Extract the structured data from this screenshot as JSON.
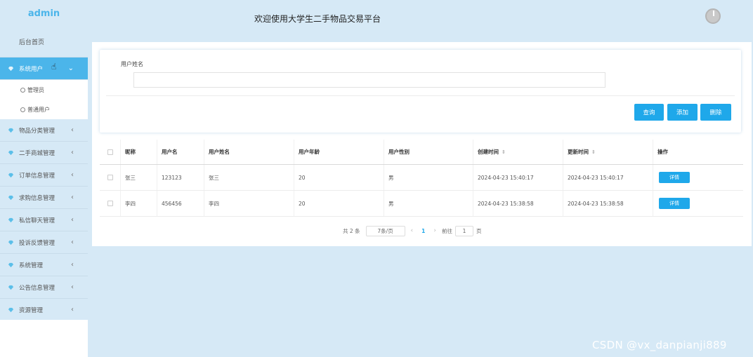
{
  "sidebar": {
    "brand": "admin",
    "home": "后台首页",
    "menus": [
      {
        "label": "系统用户",
        "icon": "gem-icon",
        "active": true
      },
      {
        "label": "物品分类管理",
        "icon": "gem-icon"
      },
      {
        "label": "二手商城管理",
        "icon": "gem-icon"
      },
      {
        "label": "订单信息管理",
        "icon": "gem-icon"
      },
      {
        "label": "求购信息管理",
        "icon": "gem-icon"
      },
      {
        "label": "私信聊天管理",
        "icon": "gem-icon"
      },
      {
        "label": "投诉反馈管理",
        "icon": "gem-icon"
      },
      {
        "label": "系统管理",
        "icon": "gem-icon"
      },
      {
        "label": "公告信息管理",
        "icon": "gem-icon"
      },
      {
        "label": "资源管理",
        "icon": "gem-icon"
      }
    ],
    "submenu": [
      "管理员",
      "普通用户"
    ]
  },
  "header": {
    "title": "欢迎使用大学生二手物品交易平台"
  },
  "search": {
    "label": "用户姓名",
    "value": "",
    "query_label": "查询",
    "add_label": "添加",
    "delete_label": "删除"
  },
  "table": {
    "headers": [
      "昵称",
      "用户名",
      "用户姓名",
      "用户年龄",
      "用户性别",
      "创建时间",
      "更新时间",
      "操作"
    ],
    "rows": [
      {
        "nickname": "张三",
        "username": "123123",
        "realname": "张三",
        "age": "20",
        "gender": "男",
        "created": "2024-04-23 15:40:17",
        "updated": "2024-04-23 15:40:17",
        "action": "详情"
      },
      {
        "nickname": "李四",
        "username": "456456",
        "realname": "李四",
        "age": "20",
        "gender": "男",
        "created": "2024-04-23 15:38:58",
        "updated": "2024-04-23 15:38:58",
        "action": "详情"
      }
    ]
  },
  "pager": {
    "total": "共 2 条",
    "page_size": "7条/页",
    "current": "1",
    "goto_label": "前往",
    "goto_value": "1",
    "page_unit": "页"
  },
  "watermark": "CSDN @vx_danpianji889",
  "colors": {
    "accent": "#1fa8ea",
    "sidebar_active": "#4bb5ea",
    "background": "#d6e9f6"
  }
}
